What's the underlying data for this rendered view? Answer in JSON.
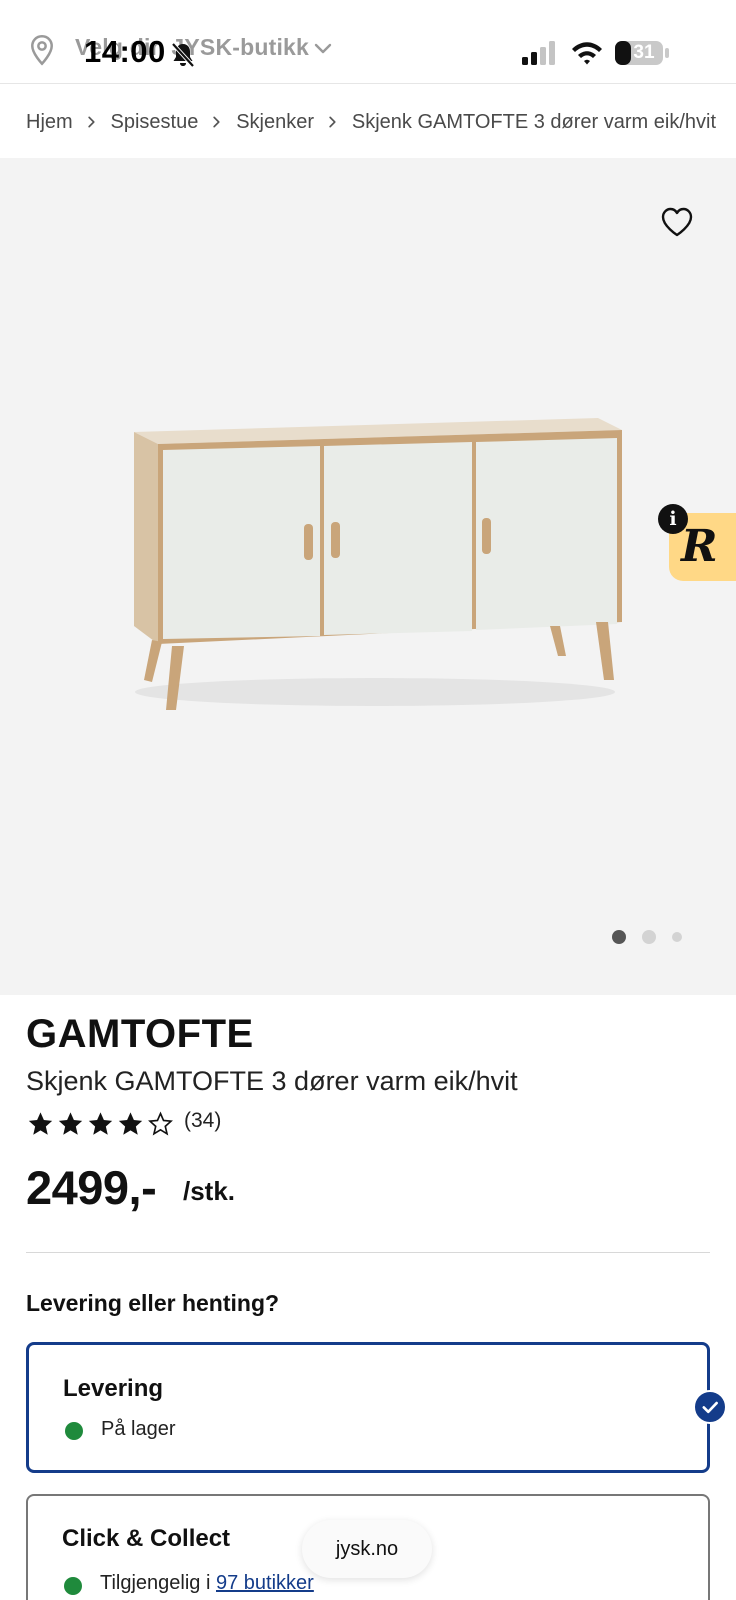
{
  "status_bar": {
    "time": "14:00",
    "battery_level": "31"
  },
  "store_selector": {
    "label": "Velg din JYSK-butikk"
  },
  "breadcrumb": [
    "Hjem",
    "Spisestue",
    "Skjenker",
    "Skjenk GAMTOFTE 3 dører varm eik/hvit"
  ],
  "gallery": {
    "slide_count": 3,
    "active_slide": 1
  },
  "product": {
    "brand": "GAMTOFTE",
    "name": "Skjenk GAMTOFTE 3 dører varm eik/hvit",
    "rating": 4,
    "rating_max": 5,
    "review_count": "(34)",
    "price": "2499,-",
    "unit": "/stk."
  },
  "delivery": {
    "heading": "Levering eller henting?",
    "options": [
      {
        "title": "Levering",
        "status": "På lager",
        "selected": true
      },
      {
        "title": "Click & Collect",
        "status_prefix": "Tilgjengelig i ",
        "status_link": "97 butikker",
        "selected": false
      }
    ]
  },
  "browser": {
    "url": "jysk.no"
  },
  "colors": {
    "accent": "#143c8a",
    "in_stock": "#1f8a3c",
    "gallery_bg": "#f3f3f3",
    "review_badge": "#ffd886"
  },
  "icons": {
    "store": "location-pin-icon",
    "wishlist": "heart-icon",
    "selected": "check-icon"
  }
}
